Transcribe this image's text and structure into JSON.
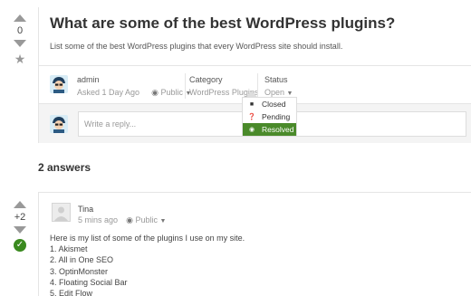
{
  "question": {
    "vote_count": "0",
    "title": "What are some of the best WordPress plugins?",
    "description": "List some of the best WordPress plugins that every WordPress site should install.",
    "author": "admin",
    "asked": "Asked 1 Day Ago",
    "visibility": "Public",
    "category_label": "Category",
    "category_value": "WordPress Plugins",
    "status_label": "Status",
    "status_value": "Open"
  },
  "reply": {
    "placeholder": "Write a reply..."
  },
  "status_menu": {
    "items": [
      {
        "label": "Closed",
        "icon": "lock-icon",
        "active": false
      },
      {
        "label": "Pending",
        "icon": "question-icon",
        "active": false
      },
      {
        "label": "Resolved",
        "icon": "resolved-icon",
        "active": true
      }
    ]
  },
  "answers_heading": "2 answers",
  "answer": {
    "vote_count": "+2",
    "author": "Tina",
    "time": "5 mins ago",
    "visibility": "Public",
    "lines": [
      "Here is my list of some of the plugins I use on my site.",
      "1. Akismet",
      "2. All in One SEO",
      "3. OptinMonster",
      "4. Floating Social Bar",
      "5. Edit Flow"
    ]
  },
  "colors": {
    "accent_green": "#4a8a2a",
    "accepted_green": "#3a8a1f",
    "border": "#e5e5e5"
  }
}
